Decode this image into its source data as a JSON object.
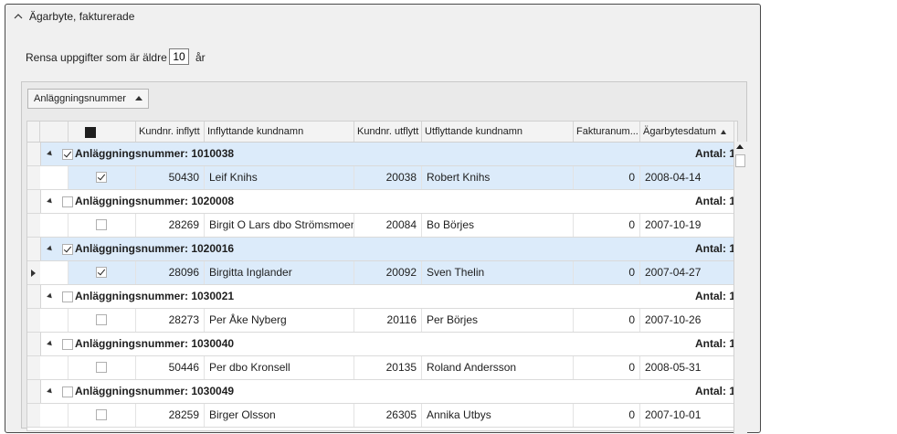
{
  "panel": {
    "title": "Ägarbyte, fakturerade",
    "option_label": "Rensa uppgifter som är äldre än",
    "option_value": "10",
    "option_unit": "år"
  },
  "grid": {
    "group_by_chip": "Anläggningsnummer",
    "columns": [
      "Kundnr. inflytt",
      "Inflyttande kundnamn",
      "Kundnr. utflytt",
      "Utflyttande kundnamn",
      "Fakturanum...",
      "Ägarbytesdatum"
    ],
    "sort_column": "Ägarbytesdatum",
    "count_prefix": "Antal:",
    "groups": [
      {
        "title": "Anläggningsnummer: 1010038",
        "count": "1",
        "checked": true,
        "selected": true,
        "row": {
          "in_nr": "50430",
          "in_name": "Leif Knihs",
          "out_nr": "20038",
          "out_name": "Robert Knihs",
          "invoice": "0",
          "date": "2008-04-14",
          "checked": true,
          "selected": true
        }
      },
      {
        "title": "Anläggningsnummer: 1020008",
        "count": "1",
        "checked": false,
        "selected": false,
        "row": {
          "in_nr": "28269",
          "in_name": "Birgit O Lars dbo Strömsmoen",
          "out_nr": "20084",
          "out_name": "Bo Börjes",
          "invoice": "0",
          "date": "2007-10-19",
          "checked": false,
          "selected": false
        }
      },
      {
        "title": "Anläggningsnummer: 1020016",
        "count": "1",
        "checked": true,
        "selected": true,
        "row": {
          "in_nr": "28096",
          "in_name": "Birgitta Inglander",
          "out_nr": "20092",
          "out_name": "Sven Thelin",
          "invoice": "0",
          "date": "2007-04-27",
          "checked": true,
          "selected": true,
          "current": true
        }
      },
      {
        "title": "Anläggningsnummer: 1030021",
        "count": "1",
        "checked": false,
        "selected": false,
        "row": {
          "in_nr": "28273",
          "in_name": "Per Åke Nyberg",
          "out_nr": "20116",
          "out_name": "Per Börjes",
          "invoice": "0",
          "date": "2007-10-26",
          "checked": false,
          "selected": false
        }
      },
      {
        "title": "Anläggningsnummer: 1030040",
        "count": "1",
        "checked": false,
        "selected": false,
        "row": {
          "in_nr": "50446",
          "in_name": "Per dbo Kronsell",
          "out_nr": "20135",
          "out_name": "Roland Andersson",
          "invoice": "0",
          "date": "2008-05-31",
          "checked": false,
          "selected": false
        }
      },
      {
        "title": "Anläggningsnummer: 1030049",
        "count": "1",
        "checked": false,
        "selected": false,
        "row": {
          "in_nr": "28259",
          "in_name": "Birger Olsson",
          "out_nr": "26305",
          "out_name": "Annika Utbys",
          "invoice": "0",
          "date": "2007-10-01",
          "checked": false,
          "selected": false
        }
      }
    ]
  },
  "icons": {
    "collapse": "chevron-up-icon",
    "sort": "sort-ascending-icon",
    "expander": "expand-triangle-icon",
    "row_pointer": "current-row-icon"
  },
  "colors": {
    "selection": "#dcebfa",
    "panel_bg": "#f0f0f0",
    "border": "#4a4a4a"
  }
}
